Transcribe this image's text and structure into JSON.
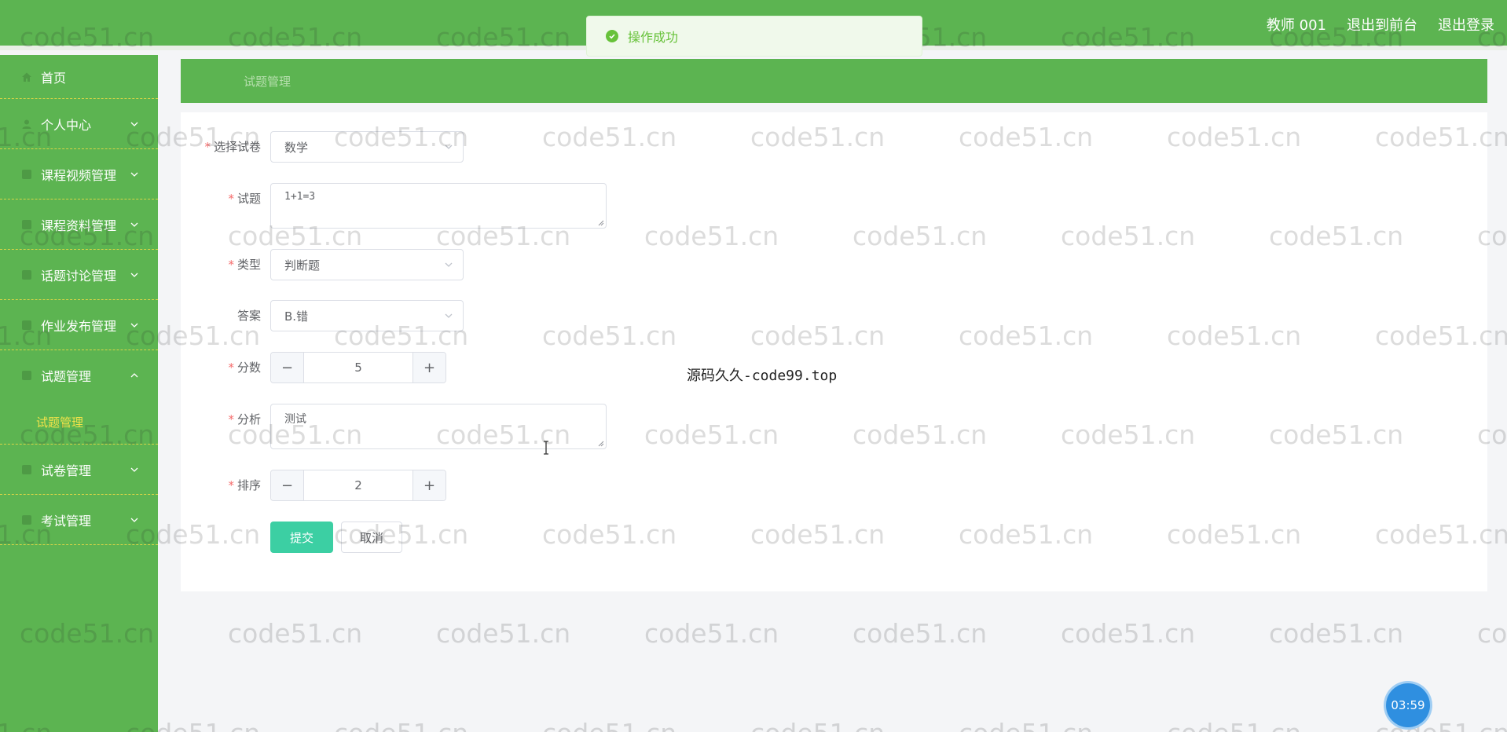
{
  "header": {
    "user_label": "教师 001",
    "front_link": "退出到前台",
    "logout_link": "退出登录"
  },
  "toast": {
    "message": "操作成功"
  },
  "sidebar": {
    "items": [
      {
        "label": "首页",
        "icon": "home-icon"
      },
      {
        "label": "个人中心",
        "icon": "user-icon"
      },
      {
        "label": "课程视频管理",
        "icon": "menu-icon"
      },
      {
        "label": "课程资料管理",
        "icon": "menu-icon"
      },
      {
        "label": "话题讨论管理",
        "icon": "menu-icon"
      },
      {
        "label": "作业发布管理",
        "icon": "menu-icon"
      },
      {
        "label": "试题管理",
        "icon": "menu-icon",
        "expanded": true
      },
      {
        "label": "试卷管理",
        "icon": "menu-icon"
      },
      {
        "label": "考试管理",
        "icon": "menu-icon"
      }
    ],
    "submenu": {
      "label": "试题管理"
    }
  },
  "breadcrumb": {
    "current": "试题管理"
  },
  "form": {
    "paper": {
      "label": "选择试卷",
      "value": "数学"
    },
    "question": {
      "label": "试题",
      "value": "1+1=3"
    },
    "type": {
      "label": "类型",
      "value": "判断题"
    },
    "answer": {
      "label": "答案",
      "value": "B.错"
    },
    "score": {
      "label": "分数",
      "value": "5",
      "minus": "−",
      "plus": "+"
    },
    "analysis": {
      "label": "分析",
      "value": "测试"
    },
    "order": {
      "label": "排序",
      "value": "2",
      "minus": "−",
      "plus": "+"
    },
    "required_mark": "*",
    "submit_label": "提交",
    "cancel_label": "取消"
  },
  "overlay": {
    "center_note": "源码久久-code99.top",
    "watermark": "code51.cn",
    "timer": "03:59"
  },
  "colors": {
    "brand_green": "#5cb451",
    "primary_button": "#3ccfa3",
    "required": "#f56c6c",
    "submenu_active": "#f0e24a",
    "timer_blue": "#2f8fe0"
  }
}
